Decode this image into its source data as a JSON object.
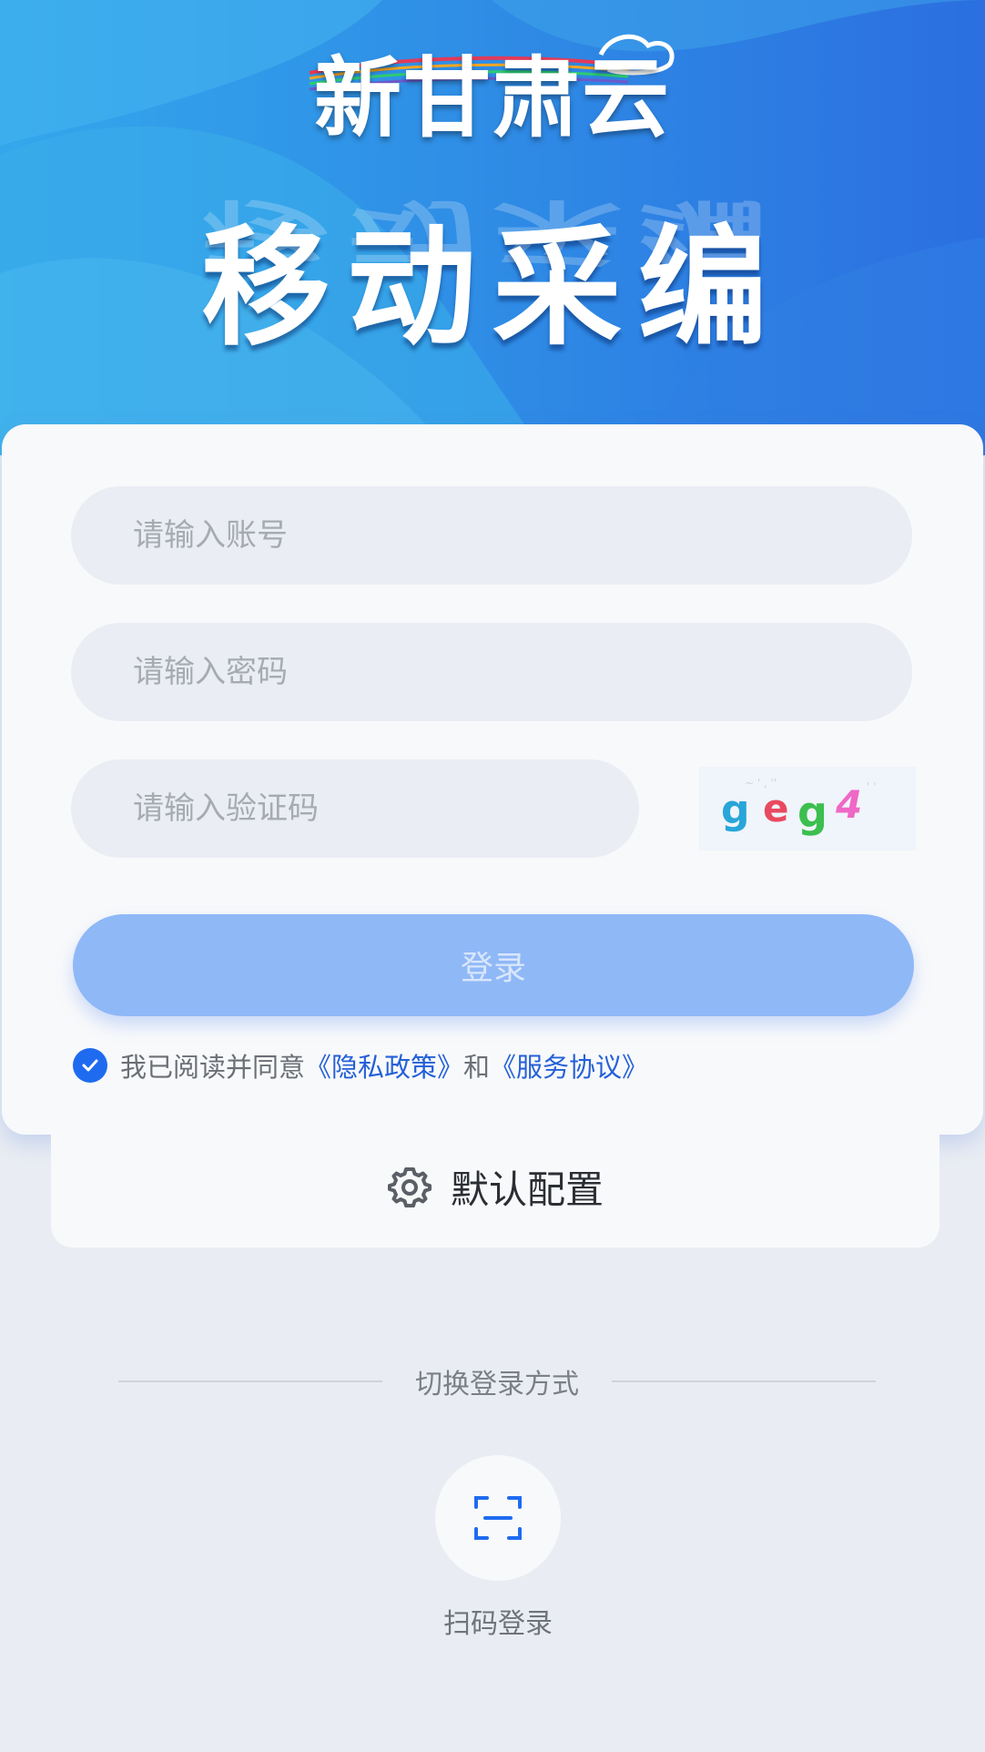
{
  "banner": {
    "brand": "新甘肃云",
    "title": "移动采编"
  },
  "login_form": {
    "account_placeholder": "请输入账号",
    "password_placeholder": "请输入密码",
    "captcha_placeholder": "请输入验证码",
    "captcha_text": "geg4",
    "login_button": "登录",
    "agreement": {
      "prefix": "我已阅读并同意",
      "privacy_link": "《隐私政策》",
      "conjunction": "和",
      "service_link": "《服务协议》",
      "checked": true
    }
  },
  "config": {
    "label": "默认配置",
    "icon": "gear-icon"
  },
  "switch_login": {
    "label": "切换登录方式",
    "scan_label": "扫码登录",
    "scan_icon": "scan-icon"
  },
  "colors": {
    "primary": "#1f6bf0",
    "login_button": "#8fb8f7",
    "link": "#2460d8",
    "banner_start": "#33a7ec",
    "banner_end": "#2b6fe0"
  }
}
